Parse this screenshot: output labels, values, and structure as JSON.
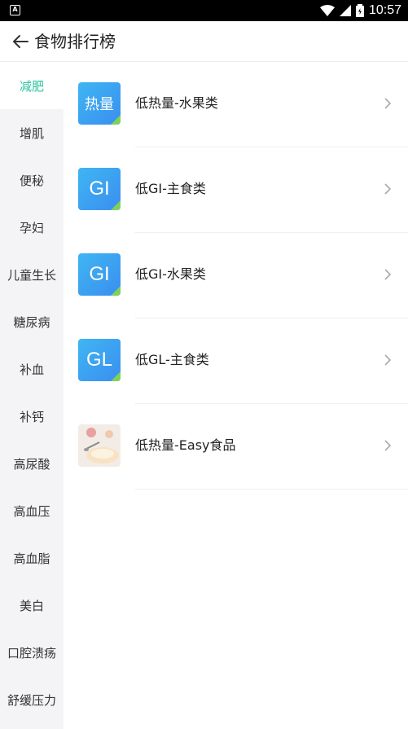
{
  "status_bar": {
    "time": "10:57",
    "notification_badge": "A"
  },
  "header": {
    "title": "食物排行榜"
  },
  "sidebar": {
    "items": [
      {
        "label": "减肥",
        "active": true
      },
      {
        "label": "增肌",
        "active": false
      },
      {
        "label": "便秘",
        "active": false
      },
      {
        "label": "孕妇",
        "active": false
      },
      {
        "label": "儿童生长",
        "active": false
      },
      {
        "label": "糖尿病",
        "active": false
      },
      {
        "label": "补血",
        "active": false
      },
      {
        "label": "补钙",
        "active": false
      },
      {
        "label": "高尿酸",
        "active": false
      },
      {
        "label": "高血压",
        "active": false
      },
      {
        "label": "高血脂",
        "active": false
      },
      {
        "label": "美白",
        "active": false
      },
      {
        "label": "口腔溃疡",
        "active": false
      },
      {
        "label": "舒缓压力",
        "active": false
      }
    ]
  },
  "list": {
    "items": [
      {
        "icon_text": "热量",
        "label": "低热量-水果类"
      },
      {
        "icon_text": "GI",
        "label": "低GI-主食类"
      },
      {
        "icon_text": "GI",
        "label": "低GI-水果类"
      },
      {
        "icon_text": "GL",
        "label": "低GL-主食类"
      },
      {
        "icon_text": "",
        "label": "低热量-Easy食品"
      }
    ]
  },
  "colors": {
    "accent": "#2bc4a0",
    "icon_blue": "#3a8ef0",
    "icon_corner": "#7fd15a",
    "sidebar_bg": "#f4f4f6"
  }
}
